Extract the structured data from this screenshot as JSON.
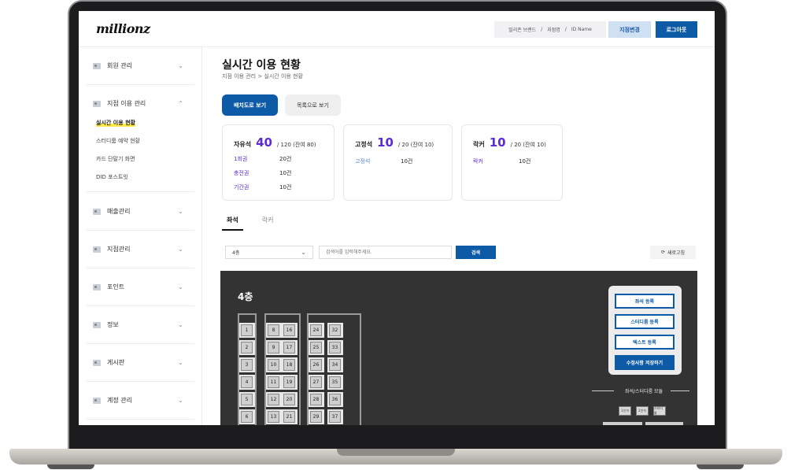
{
  "brand": {
    "logo": "millionz"
  },
  "header": {
    "breadcrumb": [
      "밀리존 브랜드",
      "지점명",
      "ID Name"
    ],
    "separator": "/",
    "change_branch": "지점변경",
    "logout": "로그아웃"
  },
  "sidebar": {
    "menus": [
      {
        "label": "회원 관리",
        "chevron": "⌄"
      },
      {
        "label": "지점 이용 관리",
        "chevron": "⌃",
        "subs": [
          "실시간 이용 현황",
          "스터디룸 예약 현황",
          "카드 단말기 화면",
          "DID 포스트잇"
        ]
      },
      {
        "label": "매출관리",
        "chevron": "⌄"
      },
      {
        "label": "지점관리",
        "chevron": "⌄"
      },
      {
        "label": "포인트",
        "chevron": "⌄"
      },
      {
        "label": "정보",
        "chevron": "⌄"
      },
      {
        "label": "게시판",
        "chevron": "⌄"
      },
      {
        "label": "계정 관리",
        "chevron": "⌄"
      }
    ]
  },
  "page": {
    "title": "실시간 이용 현황",
    "breadcrumb": "지점 이용 관리   >   실시간 이용 현황",
    "view_seat": "배치도로 보기",
    "view_list": "목록으로 보기"
  },
  "cards": [
    {
      "name": "자유석",
      "count": "40",
      "total": "/ 120 (잔여 80)",
      "rows": [
        {
          "k": "1회권",
          "v": "20건"
        },
        {
          "k": "충전권",
          "v": "10건"
        },
        {
          "k": "기간권",
          "v": "10건"
        }
      ]
    },
    {
      "name": "고정석",
      "count": "10",
      "total": "/ 20 (잔여 10)",
      "rows": [
        {
          "k": "고정석",
          "v": "10건"
        }
      ]
    },
    {
      "name": "락커",
      "count": "10",
      "total": "/ 20 (잔여 10)",
      "rows": [
        {
          "k": "락커",
          "v": "10건"
        }
      ]
    }
  ],
  "tabs": [
    "좌석",
    "락커"
  ],
  "filter": {
    "floor": "4층",
    "search_placeholder": "검색어를 입력해주세요.",
    "search": "검색",
    "refresh": "새로고침"
  },
  "map": {
    "floor": "4층",
    "columns": [
      [
        1,
        2,
        3,
        4,
        5,
        6
      ],
      [
        8,
        9,
        10,
        11,
        12,
        13
      ],
      [
        16,
        17,
        18,
        19,
        20,
        21
      ],
      [
        24,
        25,
        26,
        27,
        28,
        29
      ],
      [
        32,
        33,
        34,
        35,
        36,
        37
      ]
    ],
    "tools": [
      "좌석 등록",
      "스터디룸 등록",
      "텍스트 등록",
      "수정사항 저장하기"
    ],
    "module_title": "좌석/스터디룸 모듈",
    "modules": [
      "1인석",
      "2인석",
      "스터디룸"
    ]
  },
  "colors": {
    "primary": "#0d5aa7",
    "accent": "#5b2bd6",
    "highlight": "#ffe94d",
    "map_bg": "#333333"
  }
}
